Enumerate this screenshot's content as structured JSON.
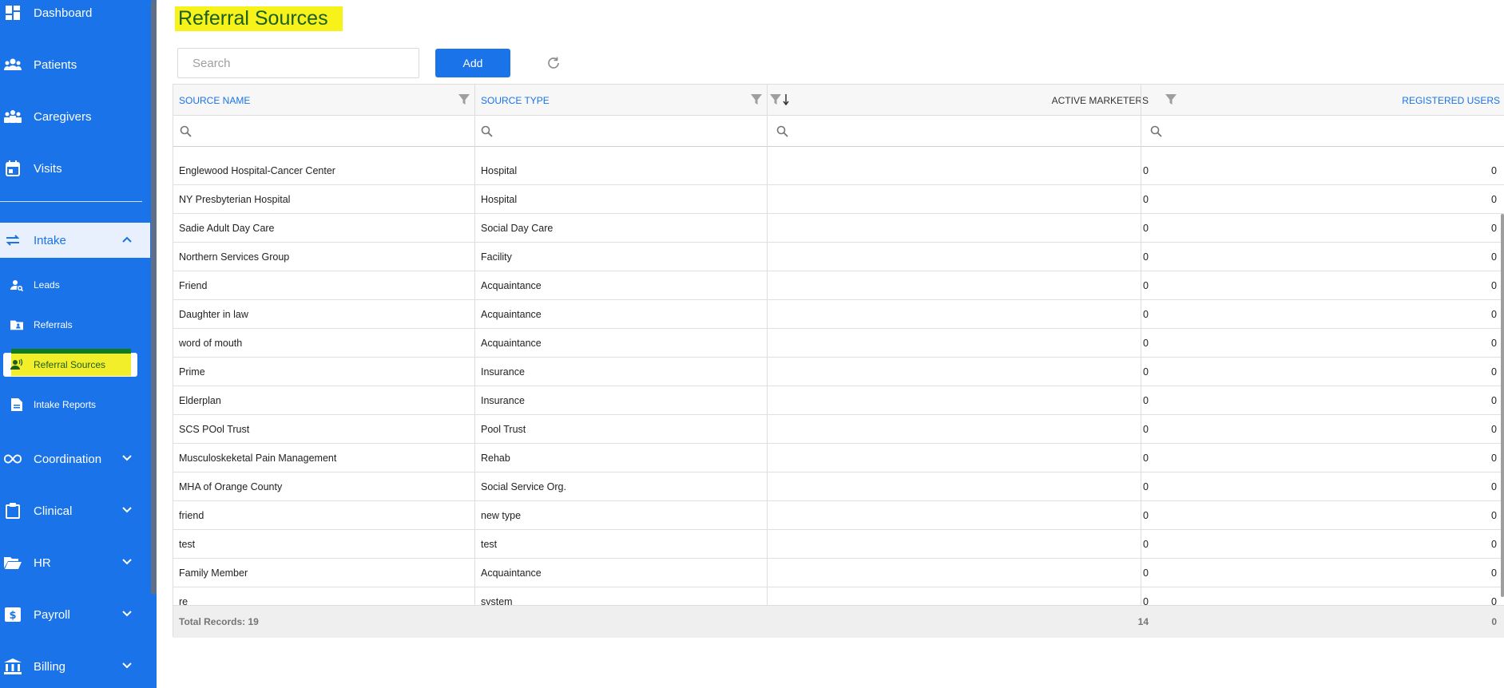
{
  "sidebar": {
    "items": [
      {
        "label": "Dashboard",
        "icon": "dashboard-icon"
      },
      {
        "label": "Patients",
        "icon": "patients-icon"
      },
      {
        "label": "Caregivers",
        "icon": "caregivers-icon"
      },
      {
        "label": "Visits",
        "icon": "calendar-icon"
      }
    ],
    "intake": {
      "label": "Intake",
      "icon": "swap-icon",
      "expanded": true
    },
    "intake_items": [
      {
        "label": "Leads",
        "icon": "person-search-icon"
      },
      {
        "label": "Referrals",
        "icon": "folder-user-icon"
      },
      {
        "label": "Referral Sources",
        "icon": "person-voice-icon",
        "selected": true
      },
      {
        "label": "Intake Reports",
        "icon": "document-icon"
      }
    ],
    "sections": [
      {
        "label": "Coordination",
        "icon": "infinity-icon"
      },
      {
        "label": "Clinical",
        "icon": "clipboard-icon"
      },
      {
        "label": "HR",
        "icon": "folder-open-icon"
      },
      {
        "label": "Payroll",
        "icon": "dollar-icon"
      },
      {
        "label": "Billing",
        "icon": "bank-icon"
      }
    ]
  },
  "page": {
    "title": "Referral Sources",
    "highlight_color": "#f7f21a"
  },
  "toolbar": {
    "search_placeholder": "Search",
    "add_label": "Add"
  },
  "table": {
    "columns": [
      "SOURCE NAME",
      "SOURCE TYPE",
      "ACTIVE MARKETERS",
      "REGISTERED USERS"
    ],
    "rows": [
      [
        "Englewood Hospital-Cancer Center",
        "Hospital",
        "0",
        "0"
      ],
      [
        "NY Presbyterian Hospital",
        "Hospital",
        "0",
        "0"
      ],
      [
        "Sadie Adult Day Care",
        "Social Day Care",
        "0",
        "0"
      ],
      [
        "Northern Services Group",
        "Facility",
        "0",
        "0"
      ],
      [
        "Friend",
        "Acquaintance",
        "0",
        "0"
      ],
      [
        "Daughter in law",
        "Acquaintance",
        "0",
        "0"
      ],
      [
        "word of mouth",
        "Acquaintance",
        "0",
        "0"
      ],
      [
        "Prime",
        "Insurance",
        "0",
        "0"
      ],
      [
        "Elderplan",
        "Insurance",
        "0",
        "0"
      ],
      [
        "SCS POol Trust",
        "Pool Trust",
        "0",
        "0"
      ],
      [
        "Musculoskeketal Pain Management",
        "Rehab",
        "0",
        "0"
      ],
      [
        "MHA of Orange County",
        "Social Service Org.",
        "0",
        "0"
      ],
      [
        "friend",
        "new type",
        "0",
        "0"
      ],
      [
        "test",
        "test",
        "0",
        "0"
      ],
      [
        "Family Member",
        "Acquaintance",
        "0",
        "0"
      ],
      [
        "re",
        "system",
        "0",
        "0"
      ]
    ],
    "footer": {
      "total_label": "Total Records: 19",
      "active_total": "14",
      "registered_total": "0"
    }
  },
  "colors": {
    "sidebar": "#1a73e8",
    "link": "#1a73e8"
  }
}
